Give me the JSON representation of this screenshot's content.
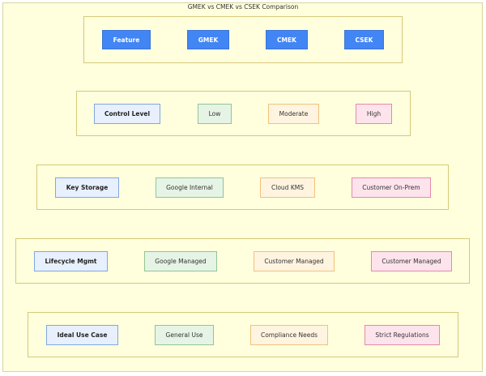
{
  "title": "GMEK vs CMEK vs CSEK Comparison",
  "header": {
    "feature": "Feature",
    "gmek": "GMEK",
    "cmek": "CMEK",
    "csek": "CSEK"
  },
  "rows": [
    {
      "label": "Control Level",
      "gmek": "Low",
      "cmek": "Moderate",
      "csek": "High"
    },
    {
      "label": "Key Storage",
      "gmek": "Google Internal",
      "cmek": "Cloud KMS",
      "csek": "Customer On-Prem"
    },
    {
      "label": "Lifecycle Mgmt",
      "gmek": "Google Managed",
      "cmek": "Customer Managed",
      "csek": "Customer Managed"
    },
    {
      "label": "Ideal Use Case",
      "gmek": "General Use",
      "cmek": "Compliance Needs",
      "csek": "Strict Regulations"
    }
  ],
  "colors": {
    "header_fill": "#4285f4",
    "label_fill": "#e8f0fe",
    "gmek_fill": "#e6f4e6",
    "cmek_fill": "#fff4e0",
    "csek_fill": "#fde4ec",
    "group_fill": "#ffffdd"
  }
}
